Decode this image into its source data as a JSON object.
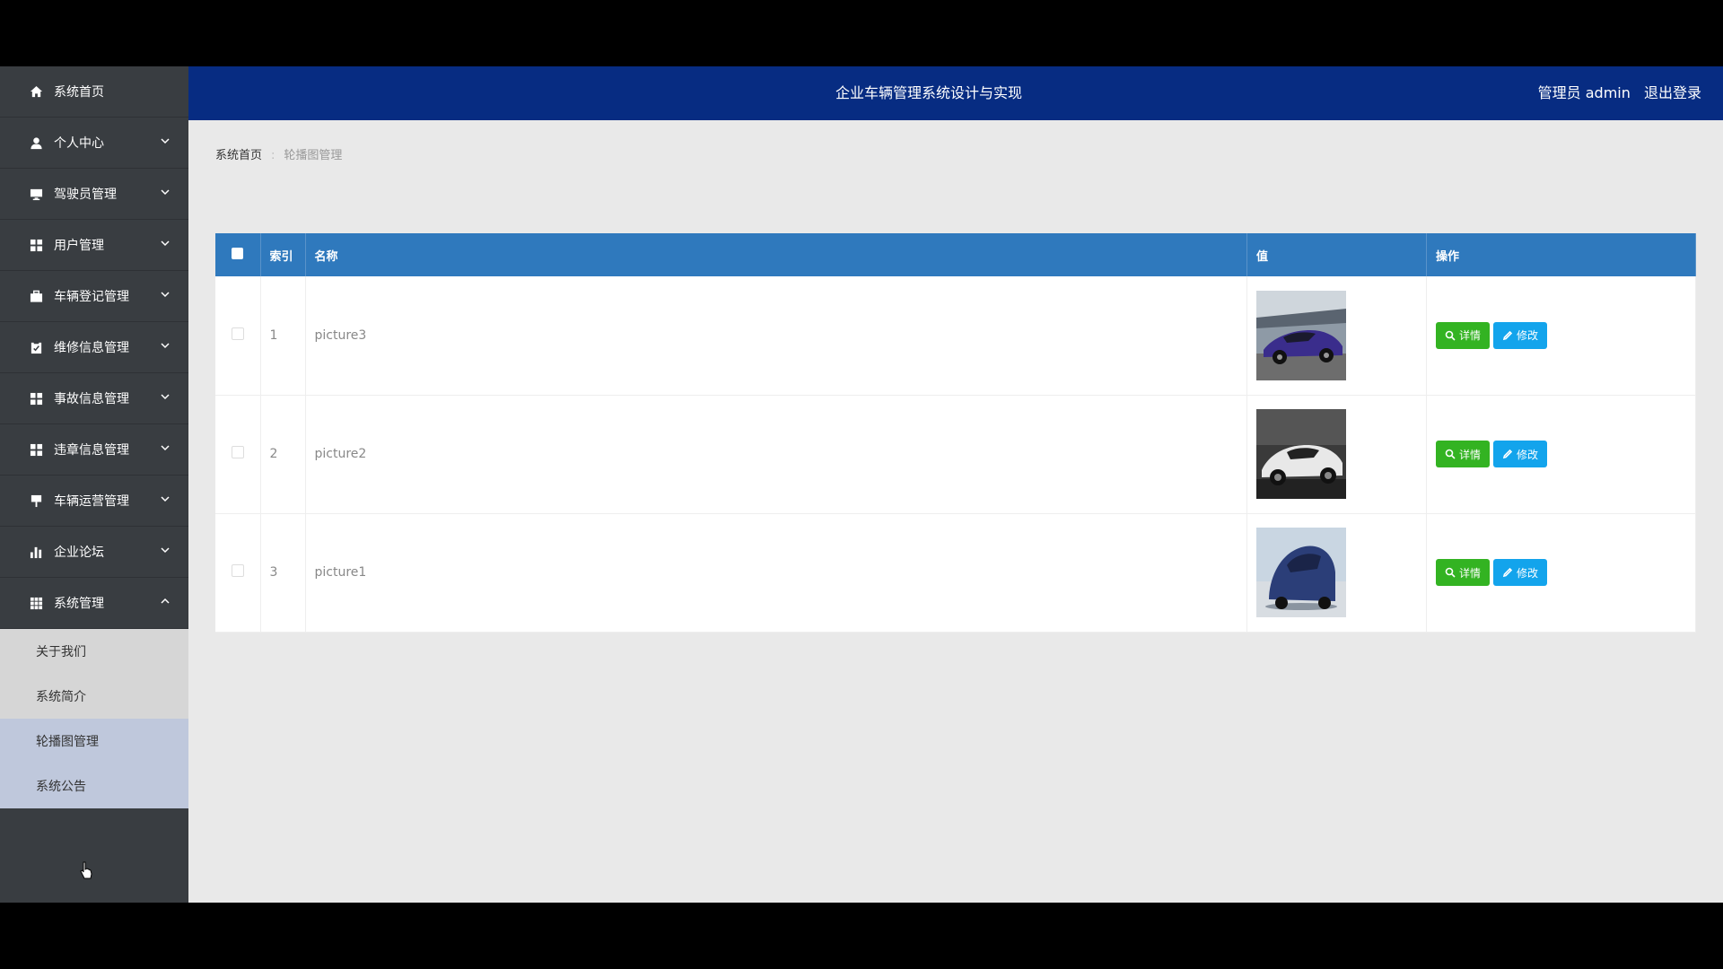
{
  "header": {
    "title": "企业车辆管理系统设计与实现",
    "user_label": "管理员 admin",
    "logout_label": "退出登录",
    "bg_color": "#072c82"
  },
  "sidebar": {
    "items": [
      {
        "label": "系统首页",
        "icon": "home-icon",
        "has_chevron": false
      },
      {
        "label": "个人中心",
        "icon": "user-icon",
        "has_chevron": true
      },
      {
        "label": "驾驶员管理",
        "icon": "monitor-icon",
        "has_chevron": true
      },
      {
        "label": "用户管理",
        "icon": "grid-icon",
        "has_chevron": true
      },
      {
        "label": "车辆登记管理",
        "icon": "briefcase-icon",
        "has_chevron": true
      },
      {
        "label": "维修信息管理",
        "icon": "clipboard-icon",
        "has_chevron": true
      },
      {
        "label": "事故信息管理",
        "icon": "grid-icon",
        "has_chevron": true
      },
      {
        "label": "违章信息管理",
        "icon": "grid-icon",
        "has_chevron": true
      },
      {
        "label": "车辆运营管理",
        "icon": "pin-icon",
        "has_chevron": true
      },
      {
        "label": "企业论坛",
        "icon": "bar-chart-icon",
        "has_chevron": true
      },
      {
        "label": "系统管理",
        "icon": "table-icon",
        "has_chevron": true,
        "expanded": true
      }
    ],
    "submenu": [
      {
        "label": "关于我们"
      },
      {
        "label": "系统简介"
      },
      {
        "label": "轮播图管理"
      },
      {
        "label": "系统公告"
      }
    ]
  },
  "breadcrumb": {
    "home": "系统首页",
    "separator": ":",
    "current": "轮播图管理"
  },
  "table": {
    "headers": [
      "索引",
      "名称",
      "值",
      "操作"
    ],
    "rows": [
      {
        "index": "1",
        "name": "picture3",
        "image": "purple-sports-car"
      },
      {
        "index": "2",
        "name": "picture2",
        "image": "white-sports-car"
      },
      {
        "index": "3",
        "name": "picture1",
        "image": "blue-sedan"
      }
    ],
    "detail_label": "详情",
    "edit_label": "修改",
    "header_color": "#2f79bd",
    "detail_color": "#33b322",
    "edit_color": "#13a4ec"
  }
}
